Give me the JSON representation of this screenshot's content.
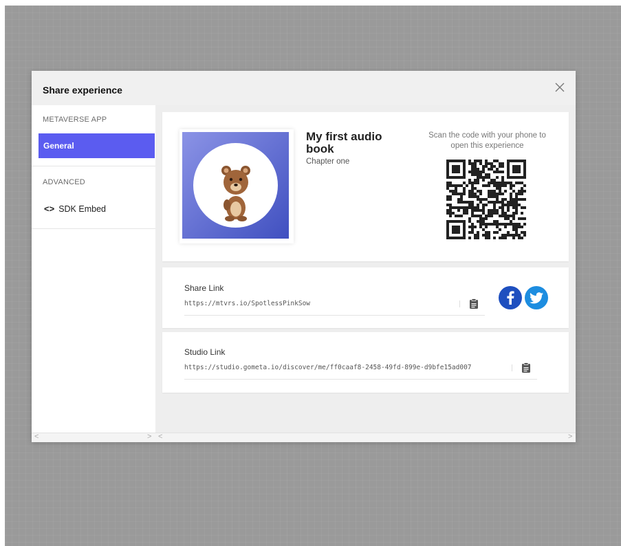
{
  "modal": {
    "title": "Share experience"
  },
  "sidebar": {
    "section1": "METAVERSE APP",
    "general": "General",
    "section2": "ADVANCED",
    "sdk_embed": "SDK Embed",
    "sdk_icon_text": "<>"
  },
  "experience": {
    "title": "My first audio book",
    "subtitle": "Chapter one",
    "qr_caption": "Scan the code with your phone to open this experience"
  },
  "share_link": {
    "label": "Share Link",
    "url": "https://mtvrs.io/SpotlessPinkSow"
  },
  "studio_link": {
    "label": "Studio Link",
    "url": "https://studio.gometa.io/discover/me/ff0caaf8-2458-49fd-899e-d9bfe15ad007"
  },
  "scroll": {
    "left": "<",
    "right": ">"
  },
  "colors": {
    "accent": "#5b5cf0",
    "facebook": "#1e4fbf",
    "twitter": "#1d8de0",
    "backdrop": "#9a9a9a"
  },
  "icons": [
    "close-icon",
    "code-icon",
    "clipboard-icon",
    "facebook-icon",
    "twitter-icon",
    "qr-code"
  ]
}
